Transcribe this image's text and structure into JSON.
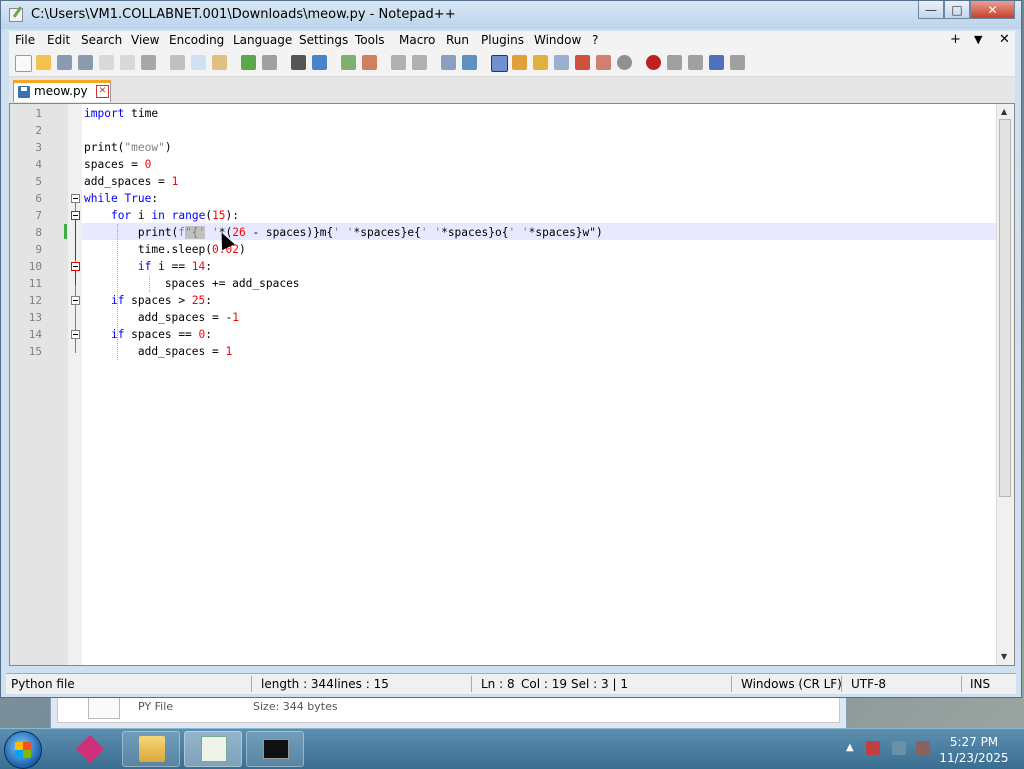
{
  "window": {
    "title": "C:\\Users\\VM1.COLLABNET.001\\Downloads\\meow.py - Notepad++"
  },
  "menu": {
    "items": [
      "File",
      "Edit",
      "Search",
      "View",
      "Encoding",
      "Language",
      "Settings",
      "Tools",
      "Macro",
      "Run",
      "Plugins",
      "Window",
      "?"
    ],
    "right": [
      "+",
      "▼",
      "✕"
    ]
  },
  "tab": {
    "label": "meow.py"
  },
  "editor": {
    "line_numbers": [
      "1",
      "2",
      "3",
      "4",
      "5",
      "6",
      "7",
      "8",
      "9",
      "10",
      "11",
      "12",
      "13",
      "14",
      "15"
    ],
    "lines": [
      "import time",
      "",
      "print(\"meow\")",
      "spaces = 0",
      "add_spaces = 1",
      "while True:",
      "    for i in range(15):",
      "        print(f\"{' '*(26 - spaces)}m{' '*spaces}e{' '*spaces}o{' '*spaces}w\")",
      "        time.sleep(0.02)",
      "        if i == 14:",
      "            spaces += add_spaces",
      "    if spaces > 25:",
      "        add_spaces = -1",
      "    if spaces == 0:",
      "        add_spaces = 1"
    ]
  },
  "status": {
    "file_type": "Python file",
    "length": "length : 344",
    "lines": "lines : 15",
    "ln": "Ln : 8",
    "col": "Col : 19",
    "sel": "Sel : 3 | 1",
    "eol": "Windows (CR LF)",
    "encoding": "UTF-8",
    "mode": "INS"
  },
  "background_window": {
    "type": "PY File",
    "size": "Size: 344 bytes"
  },
  "taskbar": {
    "time": "5:27 PM",
    "date": "11/23/2025",
    "apps": [
      "start",
      "paint-app",
      "file-explorer",
      "notepad-plus-plus",
      "command-prompt"
    ]
  },
  "colors": {
    "keyword": "#0000ff",
    "string": "#808080",
    "number": "#ff0000",
    "current_line": "#e8e8ff"
  }
}
